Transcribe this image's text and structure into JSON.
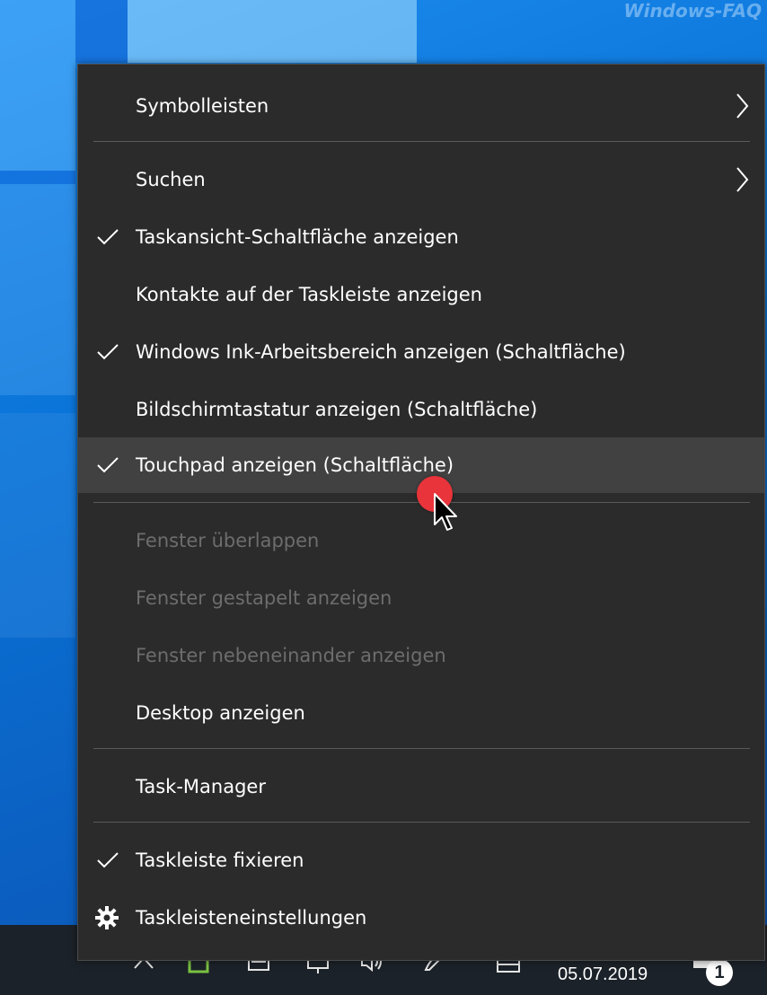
{
  "watermark": "Windows-FAQ",
  "menu": {
    "items": [
      {
        "label": "Symbolleisten",
        "checked": false,
        "submenu": true,
        "disabled": false
      },
      {
        "label": "Suchen",
        "checked": false,
        "submenu": true,
        "disabled": false
      },
      {
        "label": "Taskansicht-Schaltfläche anzeigen",
        "checked": true,
        "submenu": false,
        "disabled": false
      },
      {
        "label": "Kontakte auf der Taskleiste anzeigen",
        "checked": false,
        "submenu": false,
        "disabled": false
      },
      {
        "label": "Windows Ink-Arbeitsbereich anzeigen (Schaltfläche)",
        "checked": true,
        "submenu": false,
        "disabled": false
      },
      {
        "label": "Bildschirmtastatur anzeigen (Schaltfläche)",
        "checked": false,
        "submenu": false,
        "disabled": false
      },
      {
        "label": "Touchpad anzeigen (Schaltfläche)",
        "checked": true,
        "submenu": false,
        "disabled": false,
        "hovered": true
      },
      {
        "label": "Fenster überlappen",
        "checked": false,
        "submenu": false,
        "disabled": true
      },
      {
        "label": "Fenster gestapelt anzeigen",
        "checked": false,
        "submenu": false,
        "disabled": true
      },
      {
        "label": "Fenster nebeneinander anzeigen",
        "checked": false,
        "submenu": false,
        "disabled": true
      },
      {
        "label": "Desktop anzeigen",
        "checked": false,
        "submenu": false,
        "disabled": false
      },
      {
        "label": "Task-Manager",
        "checked": false,
        "submenu": false,
        "disabled": false
      },
      {
        "label": "Taskleiste fixieren",
        "checked": true,
        "submenu": false,
        "disabled": false
      },
      {
        "label": "Taskleisteneinstellungen",
        "checked": false,
        "submenu": false,
        "disabled": false,
        "icon": "gear-icon"
      }
    ]
  },
  "taskbar": {
    "date": "05.07.2019",
    "notification_count": "1",
    "tray_icons": [
      "chevron-up-icon",
      "app-icon",
      "keyboard-icon",
      "network-icon",
      "volume-icon",
      "pen-icon",
      "touchpad-icon",
      "notification-icon"
    ]
  },
  "colors": {
    "menu_bg": "#2b2b2b",
    "menu_hover": "#414141",
    "text": "#ffffff",
    "text_disabled": "#6d6d6d",
    "separator": "#5a5a5a",
    "taskbar_bg": "#1c2229",
    "cursor_highlight": "#e8343a"
  }
}
